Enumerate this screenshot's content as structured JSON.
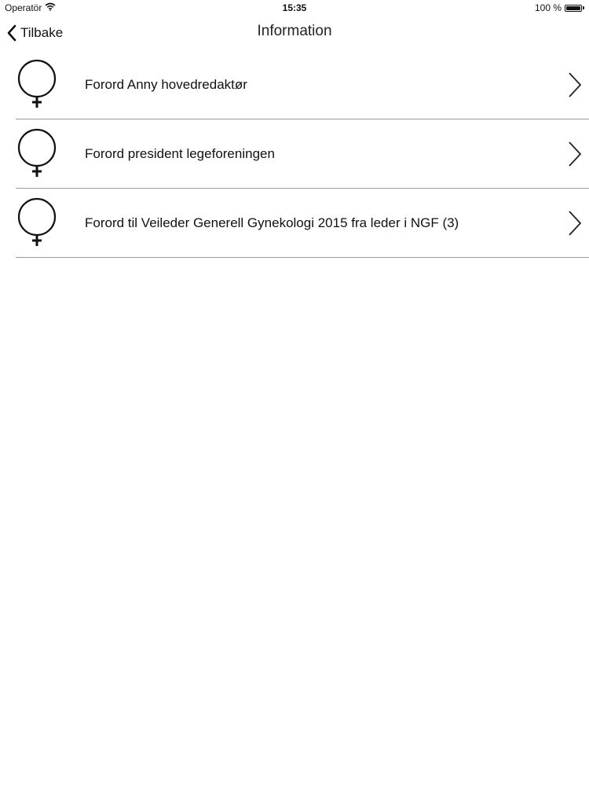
{
  "status_bar": {
    "carrier": "Operatör",
    "time": "15:35",
    "battery_text": "100 %",
    "battery_level": 1.0
  },
  "nav": {
    "back_label": "Tilbake",
    "title": "Information"
  },
  "list": {
    "items": [
      {
        "label": "Forord Anny hovedredaktør",
        "icon": "female-symbol-icon"
      },
      {
        "label": "Forord president legeforeningen",
        "icon": "female-symbol-icon"
      },
      {
        "label": "Forord til Veileder Generell Gynekologi 2015 fra leder i NGF (3)",
        "icon": "female-symbol-icon"
      }
    ]
  }
}
